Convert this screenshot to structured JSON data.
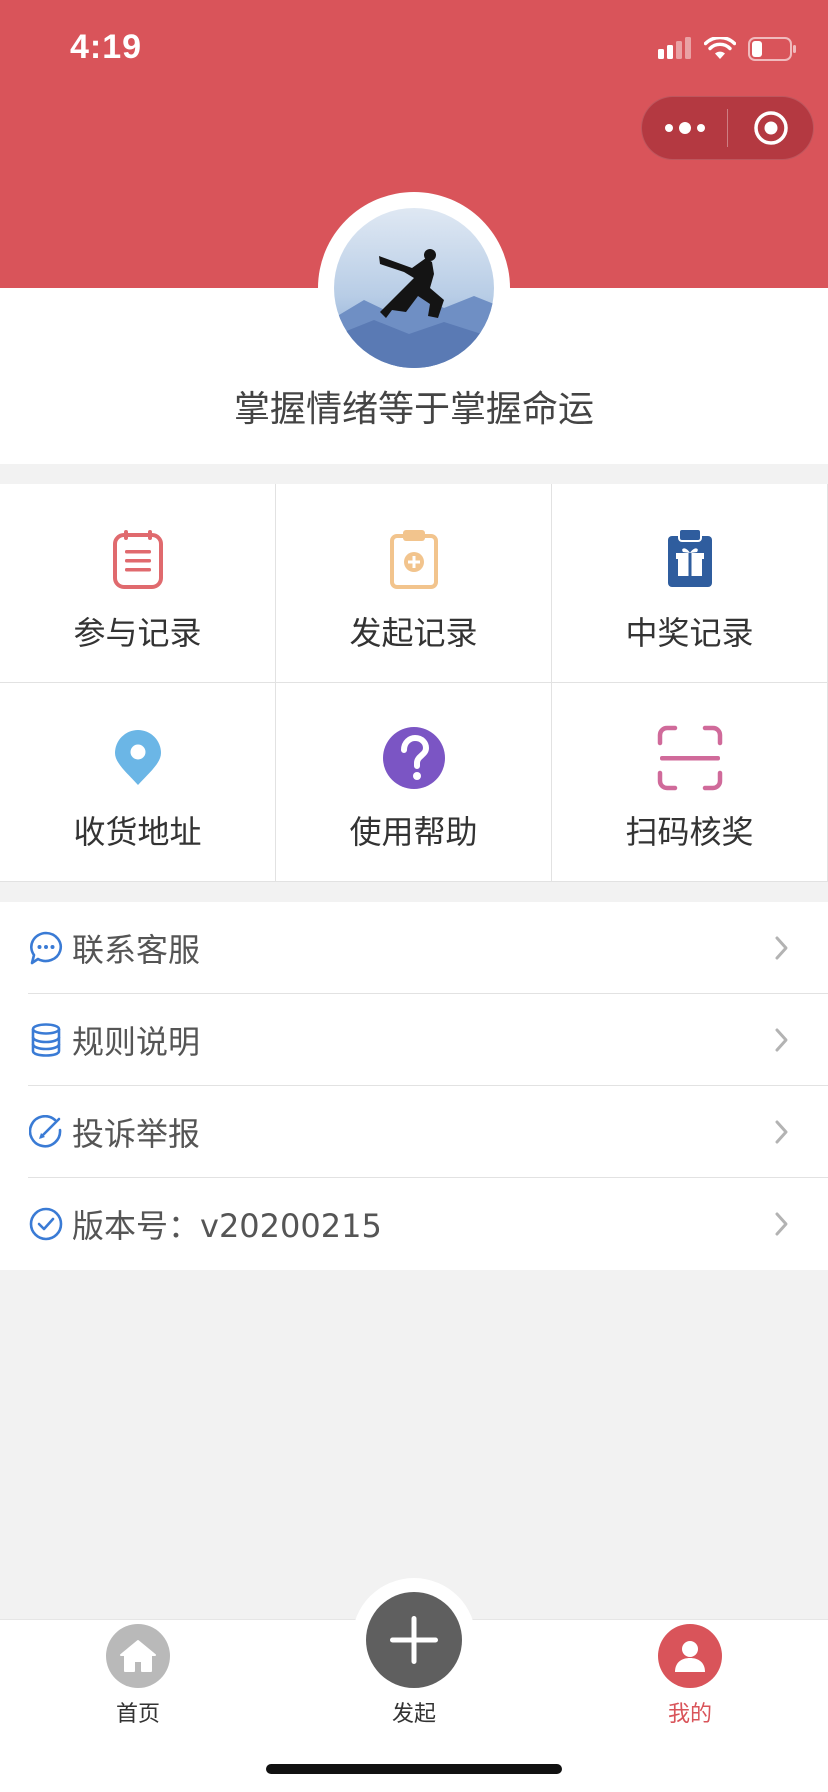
{
  "status_bar": {
    "time": "4:19"
  },
  "colors": {
    "brand_red": "#d9545a",
    "link_blue": "#3a7bd5"
  },
  "profile": {
    "nickname": "掌握情绪等于掌握命运"
  },
  "grid": {
    "items": [
      {
        "label": "参与记录",
        "icon": "clipboard-list-icon"
      },
      {
        "label": "发起记录",
        "icon": "clipboard-plus-icon"
      },
      {
        "label": "中奖记录",
        "icon": "clipboard-gift-icon"
      },
      {
        "label": "收货地址",
        "icon": "location-pin-icon"
      },
      {
        "label": "使用帮助",
        "icon": "help-question-icon"
      },
      {
        "label": "扫码核奖",
        "icon": "scan-icon"
      }
    ]
  },
  "menu": {
    "items": [
      {
        "label": "联系客服",
        "icon": "chat-bubble-icon"
      },
      {
        "label": "规则说明",
        "icon": "database-stack-icon"
      },
      {
        "label": "投诉举报",
        "icon": "edit-circle-icon"
      },
      {
        "label": "版本号：v20200215",
        "icon": "check-circle-icon"
      }
    ]
  },
  "tabbar": {
    "home": "首页",
    "create": "发起",
    "mine": "我的"
  }
}
